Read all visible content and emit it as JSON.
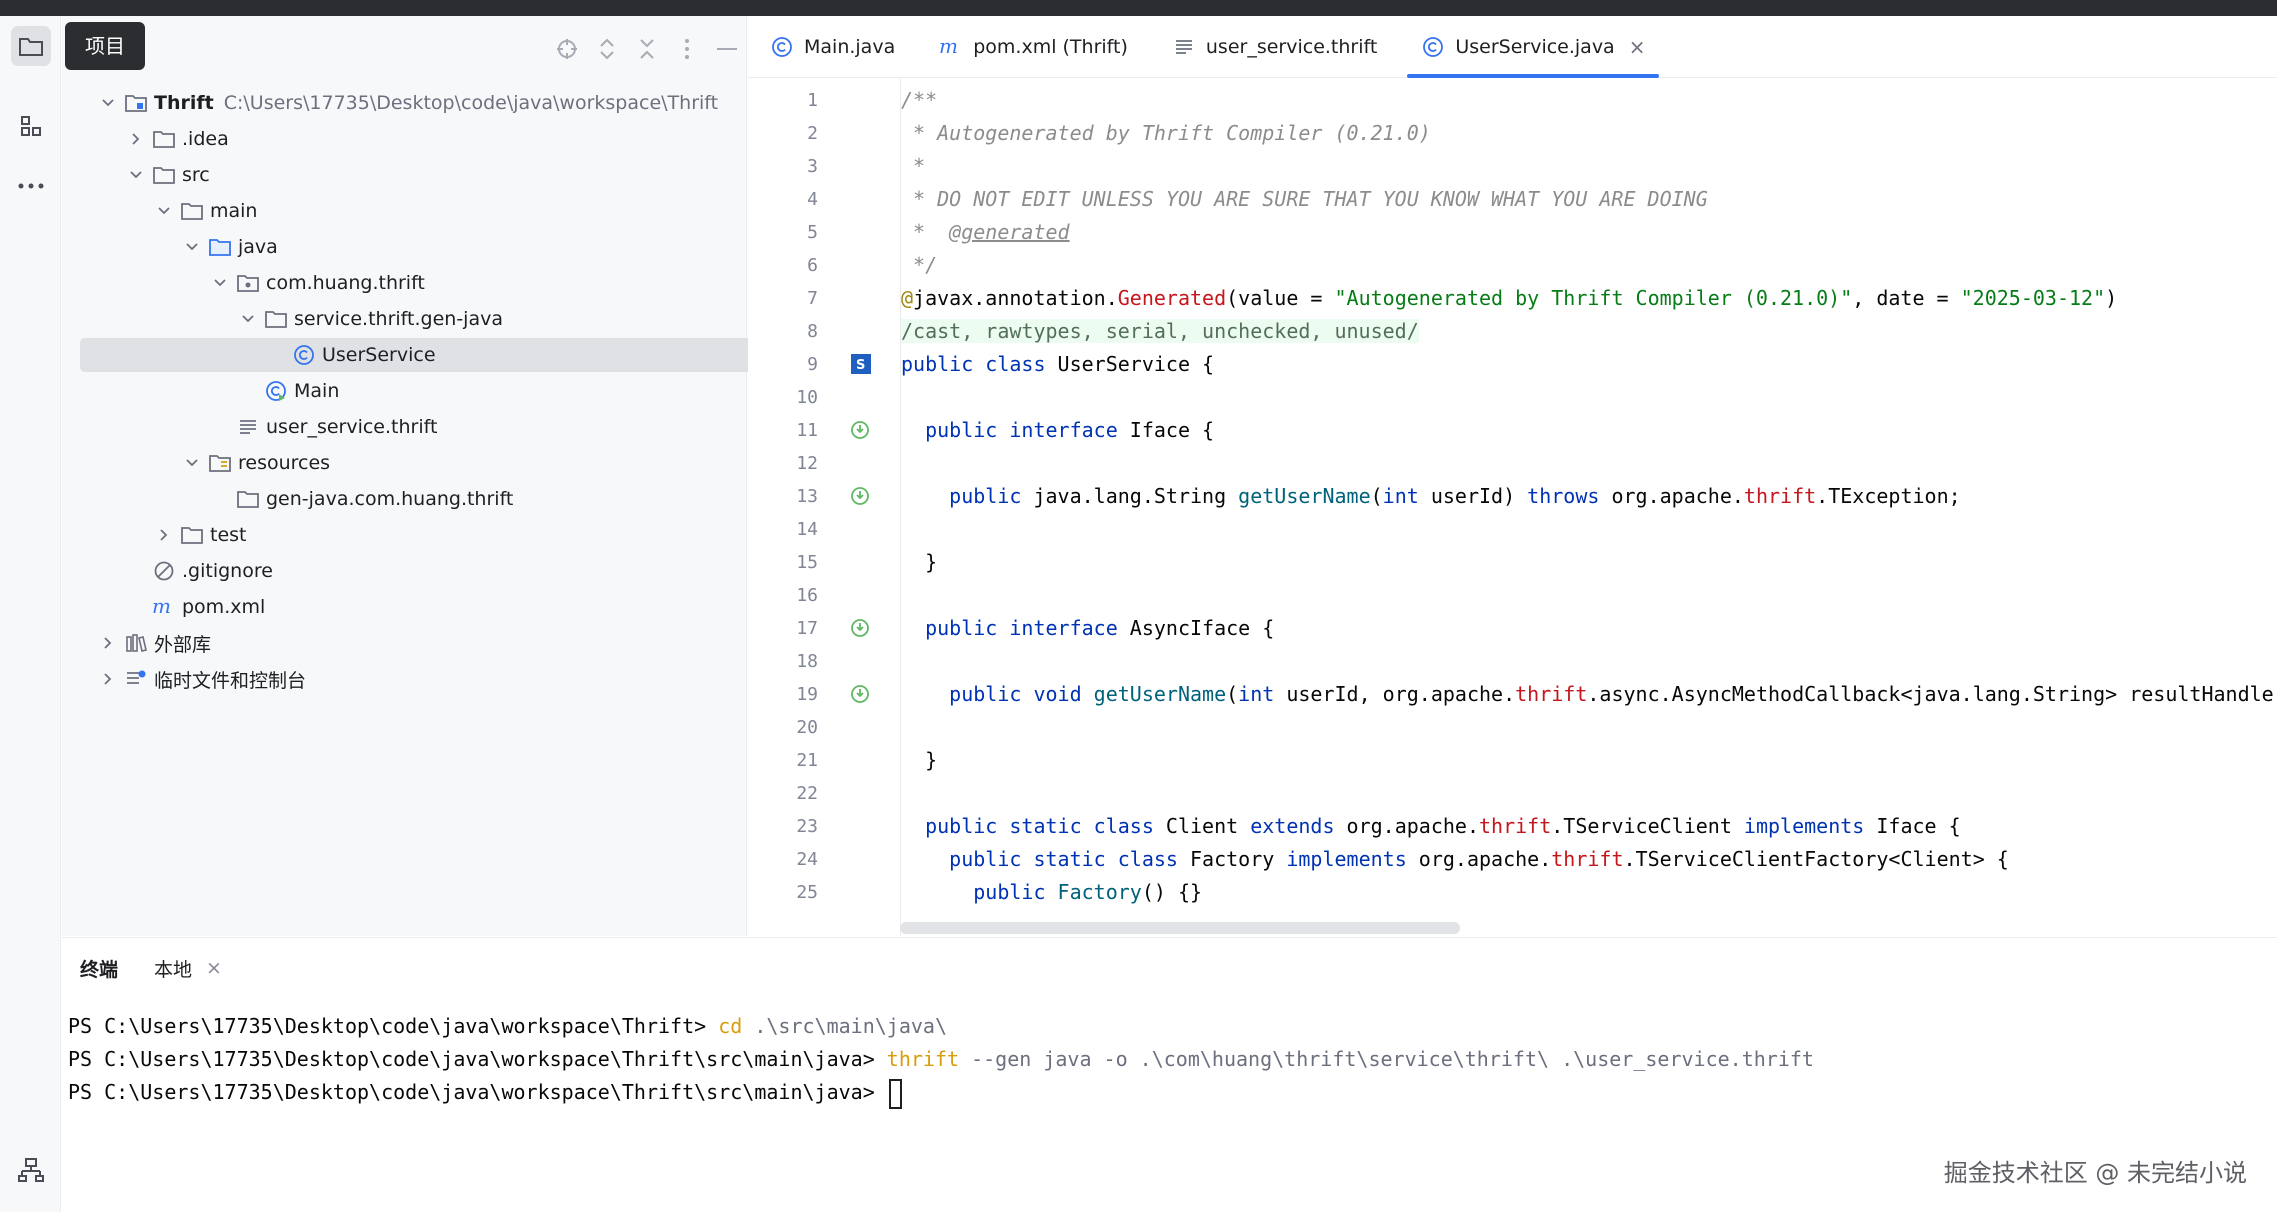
{
  "tooltip": "项目",
  "project": {
    "tree": [
      {
        "label": "Thrift",
        "path": "C:\\Users\\17735\\Desktop\\code\\java\\workspace\\Thrift",
        "bold": true,
        "depth": 0,
        "chev": "down",
        "icon": "module-folder-icon"
      },
      {
        "label": ".idea",
        "depth": 1,
        "chev": "right",
        "icon": "folder-icon"
      },
      {
        "label": "src",
        "depth": 1,
        "chev": "down",
        "icon": "folder-icon"
      },
      {
        "label": "main",
        "depth": 2,
        "chev": "down",
        "icon": "folder-icon"
      },
      {
        "label": "java",
        "depth": 3,
        "chev": "down",
        "icon": "source-folder-icon"
      },
      {
        "label": "com.huang.thrift",
        "depth": 4,
        "chev": "down",
        "icon": "package-icon"
      },
      {
        "label": "service.thrift.gen-java",
        "depth": 5,
        "chev": "down",
        "icon": "folder-icon"
      },
      {
        "label": "UserService",
        "depth": 6,
        "chev": "",
        "icon": "class-icon",
        "selected": true
      },
      {
        "label": "Main",
        "depth": 5,
        "chev": "",
        "icon": "main-class-icon"
      },
      {
        "label": "user_service.thrift",
        "depth": 4,
        "chev": "",
        "icon": "text-file-icon"
      },
      {
        "label": "resources",
        "depth": 3,
        "chev": "down",
        "icon": "resources-folder-icon"
      },
      {
        "label": "gen-java.com.huang.thrift",
        "depth": 4,
        "chev": "",
        "icon": "folder-icon"
      },
      {
        "label": "test",
        "depth": 2,
        "chev": "right",
        "icon": "folder-icon"
      },
      {
        "label": ".gitignore",
        "depth": 1,
        "chev": "",
        "icon": "ignore-file-icon"
      },
      {
        "label": "pom.xml",
        "depth": 1,
        "chev": "",
        "icon": "maven-icon"
      },
      {
        "label": "外部库",
        "depth": 0,
        "chev": "right",
        "icon": "library-icon"
      },
      {
        "label": "临时文件和控制台",
        "depth": 0,
        "chev": "right",
        "icon": "scratch-icon"
      }
    ]
  },
  "tabs": [
    {
      "label": "Main.java",
      "icon": "class-icon",
      "active": false
    },
    {
      "label": "pom.xml (Thrift)",
      "icon": "maven-icon",
      "active": false
    },
    {
      "label": "user_service.thrift",
      "icon": "text-file-icon",
      "active": false
    },
    {
      "label": "UserService.java",
      "icon": "class-icon",
      "active": true,
      "close": "×"
    }
  ],
  "code_lines": [
    {
      "n": "1",
      "html": "<span class='cmt'>/**</span>"
    },
    {
      "n": "2",
      "html": "<span class='cmt'> * Autogenerated by Thrift Compiler (0.21.0)</span>"
    },
    {
      "n": "3",
      "html": "<span class='cmt'> *</span>"
    },
    {
      "n": "4",
      "html": "<span class='cmt'> * DO NOT EDIT UNLESS YOU ARE SURE THAT YOU KNOW WHAT YOU ARE DOING</span>"
    },
    {
      "n": "5",
      "html": "<span class='cmt'> *  <span class='tag'>@generated</span></span>"
    },
    {
      "n": "6",
      "html": "<span class='cmt'> */</span>"
    },
    {
      "n": "7",
      "html": "<span class='ann'>@</span>javax.annotation.<span class='pkg'>Generated</span>(value = <span class='str'>\"Autogenerated by Thrift Compiler (0.21.0)\"</span>, date = <span class='str'>\"2025-03-12\"</span>)"
    },
    {
      "n": "8",
      "html": "<span class='sup'>/cast, rawtypes, serial, unchecked, unused/</span>"
    },
    {
      "n": "9",
      "html": "<span class='kw'>public class</span> UserService {"
    },
    {
      "n": "10",
      "html": ""
    },
    {
      "n": "11",
      "html": "  <span class='kw'>public interface</span> Iface {"
    },
    {
      "n": "12",
      "html": ""
    },
    {
      "n": "13",
      "html": "    <span class='kw'>public</span> java.lang.String <span class='fn'>getUserName</span>(<span class='kw'>int</span> userId) <span class='kw'>throws</span> org.apache.<span class='pkg'>thrift</span>.TException;"
    },
    {
      "n": "14",
      "html": ""
    },
    {
      "n": "15",
      "html": "  }"
    },
    {
      "n": "16",
      "html": ""
    },
    {
      "n": "17",
      "html": "  <span class='kw'>public interface</span> AsyncIface {"
    },
    {
      "n": "18",
      "html": ""
    },
    {
      "n": "19",
      "html": "    <span class='kw'>public void</span> <span class='fn'>getUserName</span>(<span class='kw'>int</span> userId, org.apache.<span class='pkg'>thrift</span>.async.AsyncMethodCallback&lt;java.lang.String&gt; resultHandler"
    },
    {
      "n": "20",
      "html": ""
    },
    {
      "n": "21",
      "html": "  }"
    },
    {
      "n": "22",
      "html": ""
    },
    {
      "n": "23",
      "html": "  <span class='kw'>public static class</span> Client <span class='kw'>extends</span> org.apache.<span class='pkg'>thrift</span>.TServiceClient <span class='kw'>implements</span> Iface {"
    },
    {
      "n": "24",
      "html": "    <span class='kw'>public static class</span> Factory <span class='kw'>implements</span> org.apache.<span class='pkg'>thrift</span>.TServiceClientFactory&lt;Client&gt; {"
    },
    {
      "n": "25",
      "html": "      <span class='kw'>public</span> <span class='fn'>Factory</span>() {}"
    }
  ],
  "terminal": {
    "tab_title": "终端",
    "tab_local": "本地",
    "tab_close": "×",
    "lines": [
      {
        "prompt": "PS C:\\Users\\17735\\Desktop\\code\\java\\workspace\\Thrift> ",
        "cmd": "cd",
        "args": " .\\src\\main\\java\\"
      },
      {
        "prompt": "PS C:\\Users\\17735\\Desktop\\code\\java\\workspace\\Thrift\\src\\main\\java> ",
        "cmd": "thrift",
        "args": " --gen java -o .\\com\\huang\\thrift\\service\\thrift\\ .\\user_service.thrift"
      },
      {
        "prompt": "PS C:\\Users\\17735\\Desktop\\code\\java\\workspace\\Thrift\\src\\main\\java> ",
        "cmd": "",
        "args": ""
      }
    ]
  },
  "watermark": "掘金技术社区 @ 未完结小说",
  "colors": {
    "accent": "#3574f0",
    "keyword": "#0033b3",
    "string": "#067d17",
    "comment": "#8c8c8c"
  }
}
